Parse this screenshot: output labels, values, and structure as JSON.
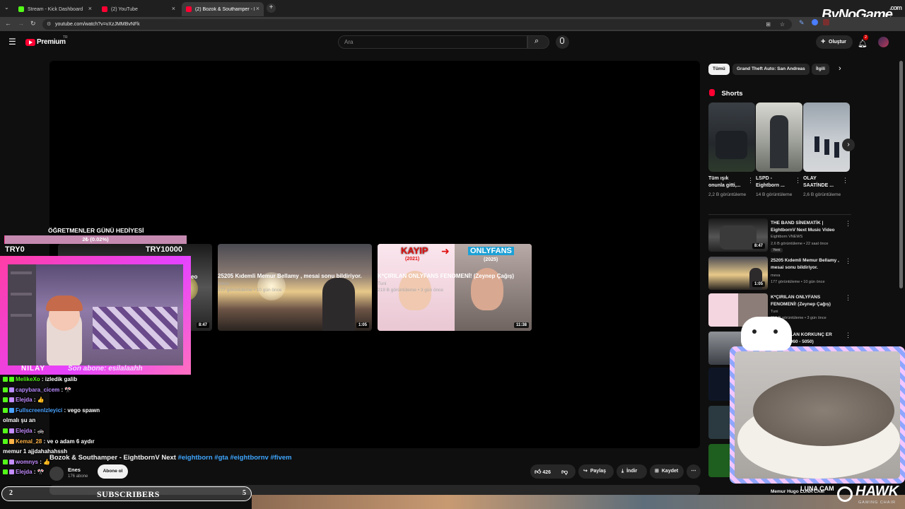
{
  "browser": {
    "tabs": [
      {
        "title": "Stream - Kick Dashboard",
        "color": "#53fc18"
      },
      {
        "title": "(2) YouTube",
        "color": "#ff0033"
      },
      {
        "title": "(2) Bozok & Southamper - Eigh",
        "color": "#ff0033"
      }
    ],
    "url": "youtube.com/watch?v=vXzJMMBvNFk"
  },
  "overlay_brand": {
    "text": "ByNoGame",
    "suffix": ".com"
  },
  "youtube": {
    "logo_text": "Premium",
    "logo_sup": "TR",
    "search_placeholder": "Ara",
    "create_label": "Oluştur",
    "notif_count": "2"
  },
  "endscreen": [
    {
      "title": "25205 Kıdemli Memur Bellamy , mesai sonu bildiriyor.",
      "channel": "meva",
      "meta": "177 görüntüleme • 10 gün önce",
      "duration": "1:05"
    },
    {
      "title": "K*ÇIRILAN ONLYFANS FENOMENİ! (Zeynep Çağış)",
      "channel": "Tuni",
      "meta": "219 B görüntüleme • 3 gün önce",
      "duration": "11:38",
      "thumb_left": "KAYIP",
      "thumb_left_year": "(2021)",
      "thumb_right": "ONLYFANS",
      "thumb_right_year": "(2025)"
    }
  ],
  "endscreen_partial": {
    "duration": "8:47",
    "title_fragment": "eo"
  },
  "chips": [
    "Tümü",
    "Grand Theft Auto: San Andreas",
    "İlgili"
  ],
  "shorts": {
    "heading": "Shorts",
    "items": [
      {
        "title": "Tüm ışık onunla gitti,...",
        "views": "2,2 B görüntüleme"
      },
      {
        "title": "LSPD - Eightborn ...",
        "views": "14 B görüntüleme"
      },
      {
        "title": "OLAY SAATİNDE ...",
        "views": "2,6 B görüntüleme"
      }
    ]
  },
  "related": [
    {
      "title": "THE BAND SİNEMATİK | EightbornV Next Music Video",
      "channel": "Eightborn VNEWS",
      "meta": "2,6 B görüntüleme • 22 saat önce",
      "badge": "Yeni",
      "duration": "8:47"
    },
    {
      "title": "25205 Kıdemli Memur Bellamy , mesai sonu bildiriyor.",
      "channel": "meva",
      "meta": "177 görüntüleme • 10 gün önce",
      "duration": "1:05"
    },
    {
      "title": "K*ÇIRILAN ONLYFANS FENOMENİ! (Zeynep Çağış)",
      "channel": "Tuni",
      "meta": "219 B görüntüleme • 3 gün önce"
    },
    {
      "title": "A SATILAN KORKUNÇ ER (RTX 4060 - 5050)",
      "channel": "",
      "meta": ""
    },
    {
      "title": "Memur Hugo LUNA CAM",
      "channel": "",
      "meta": ""
    }
  ],
  "video": {
    "title": "Bozok & Southamper - EightbornV Next",
    "hashtags": "#eightborn #gta #eightbornv #fivem",
    "channel": "Enes",
    "subs": "176 abone",
    "subscribe_label": "Abone ol",
    "likes": "426",
    "share_label": "Paylaş",
    "download_label": "İndir",
    "save_label": "Kaydet"
  },
  "stream": {
    "goal_title": "ÖĞRETMENLER GÜNÜ HEDİYESİ",
    "goal_progress": "2₺ (0.02%)",
    "goal_fraction": 0.0002,
    "goal_min": "TRY0",
    "goal_max": "TRY10000",
    "streamer_name": "NILAY",
    "last_sub": "Son abone: esilalaahh",
    "sub_label": "SUBSCRIBERS",
    "sub_left": "2",
    "sub_right": "5",
    "cam_label": "LUNA CAM",
    "hawk_text": "HAWK",
    "hawk_sub": "GAMING CHAIR"
  },
  "chat": [
    {
      "user": "MelikeXo",
      "color": "#53fc18",
      "msg": ": izledik galib"
    },
    {
      "user": "capybara_cicem",
      "color": "#b98cff",
      "msg": ": 🎌"
    },
    {
      "user": "Elejda",
      "color": "#c38cff",
      "msg": ": 👍"
    },
    {
      "user": "FullscreenIzleyici",
      "color": "#4aa3ff",
      "msg": ": vego spawn"
    },
    {
      "user": "",
      "color": "#ffffff",
      "msg": "olmalı şu an"
    },
    {
      "user": "Elejda",
      "color": "#c38cff",
      "msg": ": 🚓"
    },
    {
      "user": "Kemal_28",
      "color": "#ffb347",
      "msg": ": ve o adam 6 aydır"
    },
    {
      "user": "",
      "color": "#ffffff",
      "msg": "memur 1 ajjdahahahssh"
    },
    {
      "user": "womnys",
      "color": "#c38cff",
      "msg": ": 👍"
    },
    {
      "user": "Elejda",
      "color": "#c38cff",
      "msg": ": 🎌"
    }
  ]
}
